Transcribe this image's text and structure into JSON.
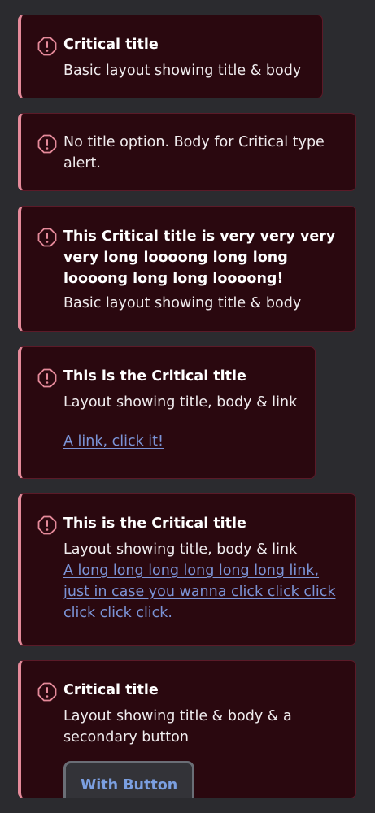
{
  "alerts": [
    {
      "icon": "critical-alert-icon",
      "title": "Critical title",
      "body": "Basic layout showing title & body"
    },
    {
      "icon": "critical-alert-icon",
      "body": "No title option. Body for Critical type alert."
    },
    {
      "icon": "critical-alert-icon",
      "title": "This Critical title is very very very very long loooong long long loooong long long loooong!",
      "body": "Basic layout showing title & body"
    },
    {
      "icon": "critical-alert-icon",
      "title": "This is the Critical title",
      "body": "Layout showing title, body & link",
      "link": "A link, click it!"
    },
    {
      "icon": "critical-alert-icon",
      "title": "This is the Critical title",
      "body": "Layout showing title, body & link",
      "link": "A long long long long long long link, just in case you wanna click click click click click click."
    },
    {
      "icon": "critical-alert-icon",
      "title": "Critical title",
      "body": "Layout showing title & body & a secondary button",
      "button": "With Button"
    }
  ],
  "colors": {
    "background": "#2b2b2f",
    "alert_background": "#2a080f",
    "alert_accent": "#e58a9a",
    "link": "#7b93d6",
    "button_text": "#7b9fe0"
  }
}
